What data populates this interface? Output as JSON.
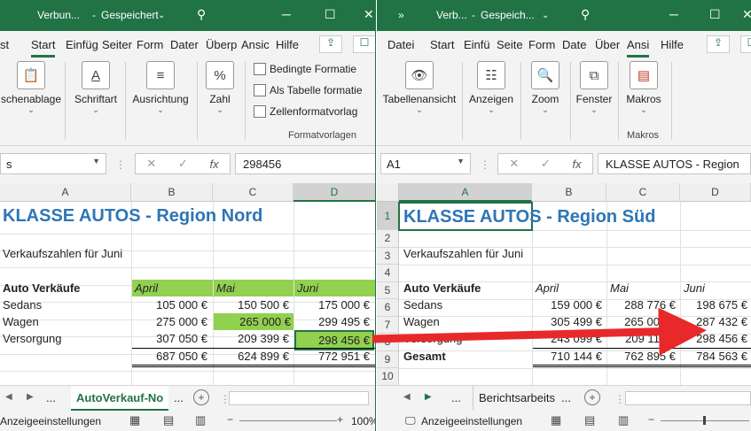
{
  "left": {
    "title": "Verbun...",
    "saved": "Gespeichert",
    "menu_tabs": [
      "Start",
      "Einfüg",
      "Seiter",
      "Form",
      "Dater",
      "Überp",
      "Ansic",
      "Hilfe"
    ],
    "ribbon": {
      "clipboard": "schenablage",
      "font": "Schriftart",
      "alignment": "Ausrichtung",
      "number": "Zahl",
      "cond_format": "Bedingte Formatie",
      "as_table": "Als Tabelle formatie",
      "cell_styles": "Zellenformatvorlag",
      "group_styles": "Formatvorlagen"
    },
    "namebox": "s",
    "formula": "298456",
    "columns": [
      "A",
      "B",
      "C",
      "D"
    ],
    "title_cell": "KLASSE AUTOS - Region Nord",
    "subtitle": "Verkaufszahlen für Juni",
    "header_label": "Auto Verkäufe",
    "months": [
      "April",
      "Mai",
      "Juni"
    ],
    "rows": [
      {
        "label": "Sedans",
        "vals": [
          "105 000 €",
          "150 500 €",
          "175 000 €"
        ]
      },
      {
        "label": "Wagen",
        "vals": [
          "275 000 €",
          "265 000 €",
          "299 495 €"
        ]
      },
      {
        "label": "Versorgung",
        "vals": [
          "307 050 €",
          "209 399 €",
          "298 456 €"
        ]
      }
    ],
    "totals": [
      "687 050 €",
      "624 899 €",
      "772 951 €"
    ],
    "sheet_tab": "AutoVerkauf-No",
    "ellipsis": "...",
    "status": "Anzeigeeinstellungen",
    "zoom": "100%"
  },
  "right": {
    "title": "Verb...",
    "saved": "Gespeich...",
    "menu_tabs": [
      "Datei",
      "Start",
      "Einfü",
      "Seite",
      "Form",
      "Date",
      "Über",
      "Ansi",
      "Hilfe"
    ],
    "ribbon": {
      "sheet_view": "Tabellenansicht",
      "show": "Anzeigen",
      "zoom": "Zoom",
      "window": "Fenster",
      "macros": "Makros",
      "group_macros": "Makros"
    },
    "namebox": "A1",
    "formula": "KLASSE AUTOS - Region",
    "columns": [
      "A",
      "B",
      "C",
      "D"
    ],
    "row_numbers": [
      "1",
      "2",
      "3",
      "4",
      "5",
      "6",
      "7",
      "8",
      "9",
      "10"
    ],
    "title_cell_a": "KLASSE AUTOS",
    "title_cell_b": " - Region Süd",
    "subtitle": "Verkaufszahlen für Juni",
    "header_label": "Auto Verkäufe",
    "months": [
      "April",
      "Mai",
      "Juni"
    ],
    "rows": [
      {
        "label": "Sedans",
        "vals": [
          "159 000 €",
          "288 776 €",
          "198 675 €"
        ]
      },
      {
        "label": "Wagen",
        "vals": [
          "305 499 €",
          "265 000 €",
          "287 432 €"
        ]
      },
      {
        "label": "Versorgung",
        "vals": [
          "243 099 €",
          "209 119 €",
          "298 456 €"
        ]
      }
    ],
    "total_label": "Gesamt",
    "totals": [
      "710 144 €",
      "762 895 €",
      "784 563 €"
    ],
    "sheet_tab": "Berichtsarbeits",
    "ellipsis": "...",
    "status": "Anzeigeeinstellungen"
  },
  "colors": {
    "excel_green": "#217346",
    "highlight": "#92d050",
    "title_blue": "#2e75b6",
    "arrow_red": "#e8292b"
  }
}
